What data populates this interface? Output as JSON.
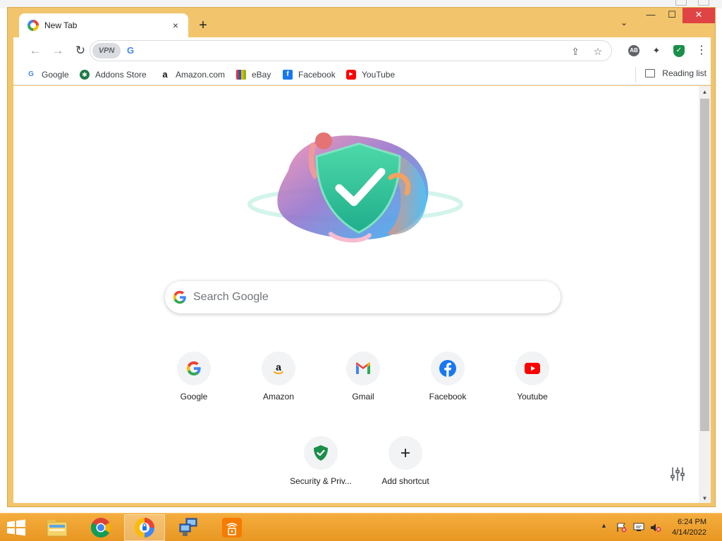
{
  "browser": {
    "tab": {
      "title": "New Tab",
      "close": "×"
    },
    "new_tab": "+",
    "tab_search": "⌄",
    "window_controls": {
      "minimize": "—",
      "maximize": "☐",
      "close": "✕"
    }
  },
  "toolbar": {
    "back": "←",
    "forward": "→",
    "reload": "↻",
    "vpn_label": "VPN",
    "omnibox_search_engine": "G",
    "omnibox_value": "",
    "share": "⇪",
    "bookmark_star": "☆",
    "adblock_label": "AB",
    "extensions": "✦",
    "shield_check": "✓",
    "menu": "⋮"
  },
  "bookmarks": [
    {
      "label": "Google",
      "icon": "google-icon",
      "glyph": "G",
      "color": "#4285f4"
    },
    {
      "label": "Addons Store",
      "icon": "addons-store-icon",
      "glyph": "✱",
      "color": "#1e7a45"
    },
    {
      "label": "Amazon.com",
      "icon": "amazon-icon",
      "glyph": "a",
      "color": "#111111"
    },
    {
      "label": "eBay",
      "icon": "ebay-icon",
      "glyph": "■",
      "color": "#e53238"
    },
    {
      "label": "Facebook",
      "icon": "facebook-icon",
      "glyph": "f",
      "color": "#1877f2"
    },
    {
      "label": "YouTube",
      "icon": "youtube-icon",
      "glyph": "▶",
      "color": "#ff0000"
    }
  ],
  "reading_list": "Reading list",
  "search": {
    "placeholder": "Search Google"
  },
  "shortcuts": [
    {
      "label": "Google",
      "icon": "google-icon"
    },
    {
      "label": "Amazon",
      "icon": "amazon-icon"
    },
    {
      "label": "Gmail",
      "icon": "gmail-icon"
    },
    {
      "label": "Facebook",
      "icon": "facebook-icon"
    },
    {
      "label": "Youtube",
      "icon": "youtube-icon"
    },
    {
      "label": "Security & Priv...",
      "icon": "security-shield-icon"
    },
    {
      "label": "Add shortcut",
      "icon": "plus-icon"
    }
  ],
  "taskbar": {
    "apps": [
      "file-explorer-icon",
      "chrome-icon",
      "secure-browser-icon",
      "network-computer-icon",
      "vpn-lock-icon"
    ],
    "active_app": "secure-browser-icon",
    "tray_expand": "▲"
  },
  "clock": {
    "time": "6:24 PM",
    "date": "4/14/2022"
  },
  "colors": {
    "window_frame": "#f2c56c",
    "taskbar": "#eea23a",
    "close_button": "#e04343",
    "accent_green": "#1a8f4a"
  }
}
